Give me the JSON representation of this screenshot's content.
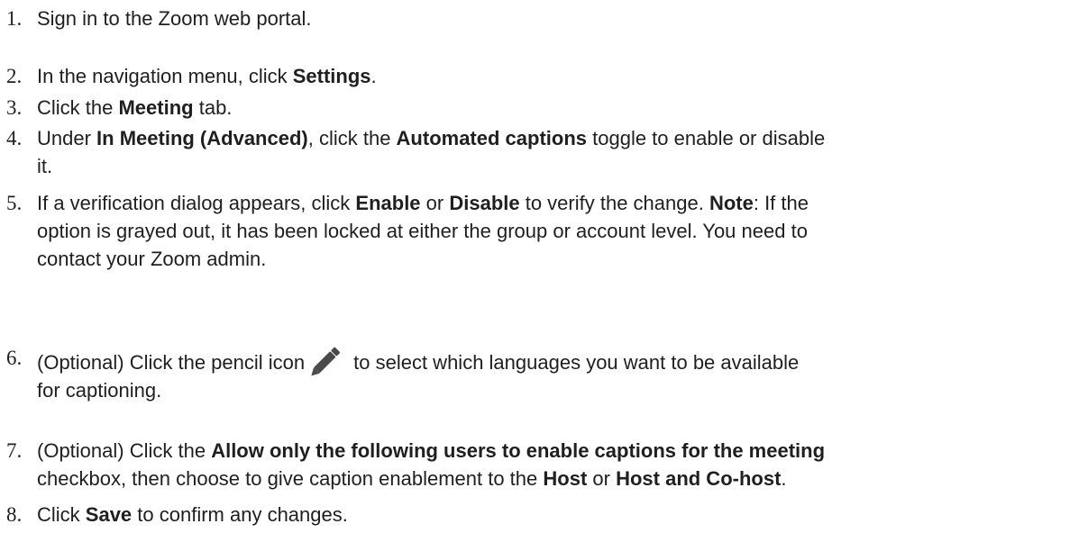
{
  "steps": [
    {
      "number": "1.",
      "parts": [
        {
          "text": "Sign in to the Zoom web portal."
        }
      ]
    },
    {
      "number": "2.",
      "parts": [
        {
          "text": "In the navigation menu, click "
        },
        {
          "text": "Settings",
          "bold": true
        },
        {
          "text": "."
        }
      ]
    },
    {
      "number": "3.",
      "parts": [
        {
          "text": "Click the "
        },
        {
          "text": "Meeting",
          "bold": true
        },
        {
          "text": " tab."
        }
      ]
    },
    {
      "number": "4.",
      "parts": [
        {
          "text": "Under "
        },
        {
          "text": "In Meeting (Advanced)",
          "bold": true
        },
        {
          "text": ", click the "
        },
        {
          "text": "Automated captions",
          "bold": true
        },
        {
          "text": " toggle to enable or disable"
        },
        {
          "break": true
        },
        {
          "text": "it."
        }
      ]
    },
    {
      "number": "5.",
      "parts": [
        {
          "text": "If a verification dialog appears, click "
        },
        {
          "text": "Enable",
          "bold": true
        },
        {
          "text": " or "
        },
        {
          "text": "Disable",
          "bold": true
        },
        {
          "text": " to verify the change. "
        },
        {
          "text": "Note",
          "bold": true
        },
        {
          "text": ": If the"
        },
        {
          "break": true
        },
        {
          "text": "option is grayed out, it has been locked at either the group or account level. You need to"
        },
        {
          "break": true
        },
        {
          "text": "contact your Zoom admin."
        }
      ]
    },
    {
      "number": "6.",
      "parts": [
        {
          "text": "(Optional) Click the pencil icon"
        },
        {
          "icon": "pencil-icon"
        },
        {
          "text": "to select which languages you want to be available"
        },
        {
          "break": true
        },
        {
          "text": "for captioning."
        }
      ]
    },
    {
      "number": "7.",
      "parts": [
        {
          "text": "(Optional) Click the "
        },
        {
          "text": "Allow only the following users to enable captions for the meeting",
          "bold": true
        },
        {
          "break": true
        },
        {
          "text": "checkbox, then choose to give caption enablement to the "
        },
        {
          "text": "Host",
          "bold": true
        },
        {
          "text": " or "
        },
        {
          "text": "Host and Co-host",
          "bold": true
        },
        {
          "text": "."
        }
      ]
    },
    {
      "number": "8.",
      "parts": [
        {
          "text": "Click "
        },
        {
          "text": "Save",
          "bold": true
        },
        {
          "text": " to confirm any changes."
        }
      ]
    }
  ],
  "icon_color": "#4a4a4a"
}
